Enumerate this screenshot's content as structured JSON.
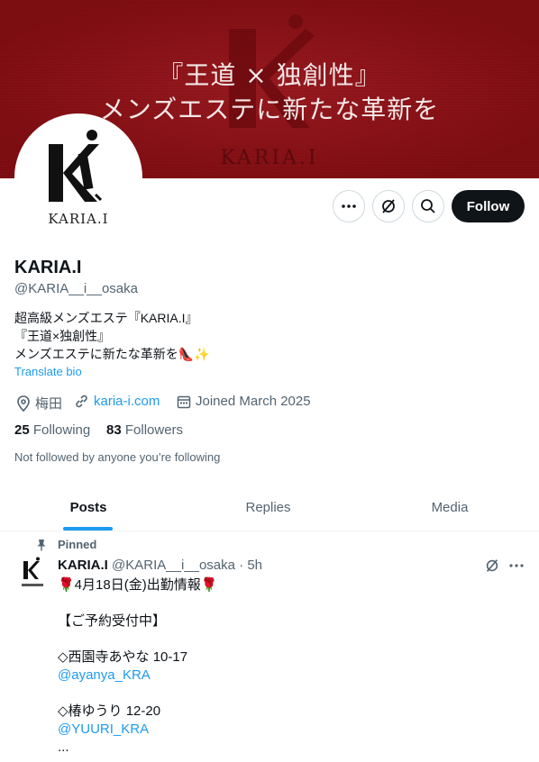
{
  "banner": {
    "line1": "『王道 × 独創性』",
    "line2": "メンズエステに新たな革新を",
    "brand": "KARIA.I"
  },
  "avatar": {
    "brand": "KARIA.I"
  },
  "actions": {
    "follow_label": "Follow"
  },
  "profile": {
    "name": "KARIA.I",
    "handle": "@KARIA__i__osaka",
    "bio_line1": "超高級メンズエステ『KARIA.I』",
    "bio_line2": "『王道×独創性』",
    "bio_line3": "メンズエステに新たな革新を👠✨",
    "translate": "Translate bio",
    "location": "梅田",
    "website": "karia-i.com",
    "joined": "Joined March 2025",
    "following_count": "25",
    "following_label": "Following",
    "followers_count": "83",
    "followers_label": "Followers",
    "not_followed": "Not followed by anyone you’re following"
  },
  "tabs": [
    "Posts",
    "Replies",
    "Media"
  ],
  "post": {
    "pinned_label": "Pinned",
    "author": "KARIA.I",
    "meta": "@KARIA__i__osaka · 5h",
    "line1": "🌹4月18日(金)出勤情報🌹",
    "line2": "【ご予約受付中】",
    "line3": "◇西園寺あやな 10-17",
    "mention1": "@ayanya_KRA",
    "line4": "◇椿ゆうり 12-20",
    "mention2": "@YUURI_KRA",
    "line5": "..."
  },
  "colors": {
    "banner": "#8a1015",
    "accent": "#1d9bf0",
    "text": "#0f1419",
    "muted": "#536471"
  }
}
